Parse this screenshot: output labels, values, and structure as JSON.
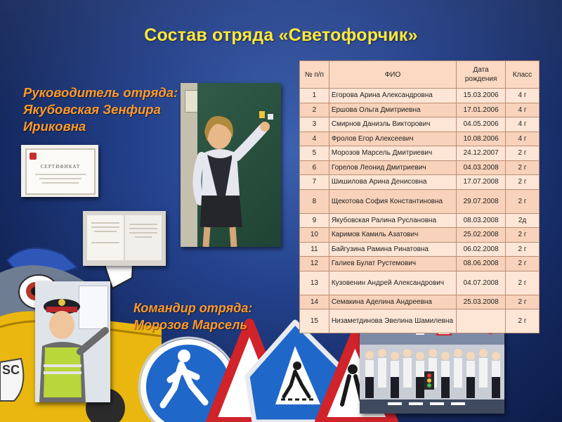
{
  "slide": {
    "title": "Состав отряда «Светофорчик»",
    "leader_caption": [
      "Руководитель отряда:",
      "Якубовская Зенфира",
      "Ириковна"
    ],
    "commander_caption": [
      "Командир отряда:",
      "Морозов Марсель"
    ]
  },
  "certificates": {
    "certificate_label": "СЕРТИФИКАТ"
  },
  "roster": {
    "headers": [
      "№ п/п",
      "ФИО",
      "Дата рождения",
      "Класс"
    ],
    "rows": [
      [
        "1",
        "Егорова Арина Александровна",
        "15.03.2006",
        "4 г"
      ],
      [
        "2",
        "Ершова Ольга Дмитриевна",
        "17.01.2006",
        "4 г"
      ],
      [
        "3",
        "Смирнов Даниэль Викторович",
        "04.05.2006",
        "4 г"
      ],
      [
        "4",
        "Фролов Егор Алексеевич",
        "10.08.2006",
        "4 г"
      ],
      [
        "5",
        "Морозов Марсель Дмитриевич",
        "24.12.2007",
        "2 г"
      ],
      [
        "6",
        "Горелов Леонид Дмитриевич",
        "04.03.2008",
        "2 г"
      ],
      [
        "7",
        "Шишилова Арина Денисовна",
        "17.07.2008",
        "2 г"
      ],
      [
        "8",
        "Щекотова София Константиновна",
        "29.07.2008",
        "2 г"
      ],
      [
        "9",
        "Якубовская Ралина Руслановна",
        "08.03.2008",
        "2д"
      ],
      [
        "10",
        "Каримов Камиль Азатович",
        "25.02.2008",
        "2 г"
      ],
      [
        "11",
        "Байгузина Рамина Ринатовна",
        "06.02.2008",
        "2 г"
      ],
      [
        "12",
        "Галиев Булат Рустемович",
        "08.06.2008",
        "2 г"
      ],
      [
        "13",
        "Кузовенин Андрей Александрович",
        "04.07.2008",
        "2 г"
      ],
      [
        "14",
        "Семакина Аделина Андреевна",
        "25.03.2008",
        "2 г"
      ],
      [
        "15",
        "Низаметдинова Эвелина Шамилевна",
        "",
        "2 г"
      ]
    ]
  },
  "colors": {
    "title": "#ffe83a",
    "caption": "#ff9a2a",
    "table_header": "#fbd9c2",
    "table_row_light": "#fde6d6",
    "table_row_dark": "#f8d2ba",
    "background": "#23408a"
  },
  "icons": [
    "road-sign-pedestrian-icon",
    "road-sign-crosswalk-icon",
    "road-sign-warning-icon",
    "cartoon-owl-mascot-icon"
  ]
}
